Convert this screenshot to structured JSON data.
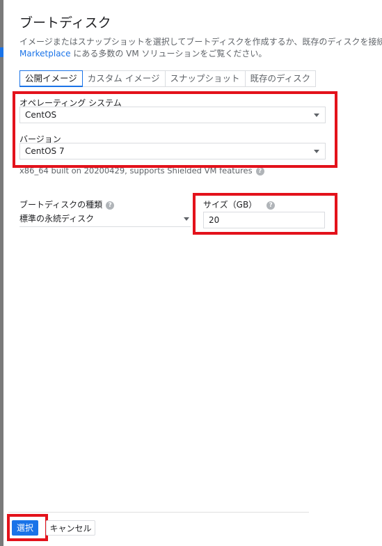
{
  "dialog": {
    "title": "ブートディスク",
    "description_line1": "イメージまたはスナップショットを選択してブートディスクを作成するか、既存のディスクを接続",
    "description_link": "Marketplace",
    "description_line2_rest": " にある多数の VM ソリューションをご覧ください。"
  },
  "tabs": [
    {
      "label": "公開イメージ",
      "active": true
    },
    {
      "label": "カスタム イメージ"
    },
    {
      "label": "スナップショット"
    },
    {
      "label": "既存のディスク"
    }
  ],
  "os": {
    "label": "オペレーティング システム",
    "value": "CentOS"
  },
  "version": {
    "label": "バージョン",
    "value": "CentOS 7",
    "info": "x86_64 built on 20200429, supports Shielded VM features"
  },
  "disk_type": {
    "label": "ブートディスクの種類",
    "value": "標準の永続ディスク"
  },
  "size": {
    "label": "サイズ（GB）",
    "value": "20"
  },
  "footer": {
    "select_label": "選択",
    "cancel_label": "キャンセル"
  },
  "colors": {
    "accent": "#1a73e8",
    "highlight": "#e3121b"
  }
}
